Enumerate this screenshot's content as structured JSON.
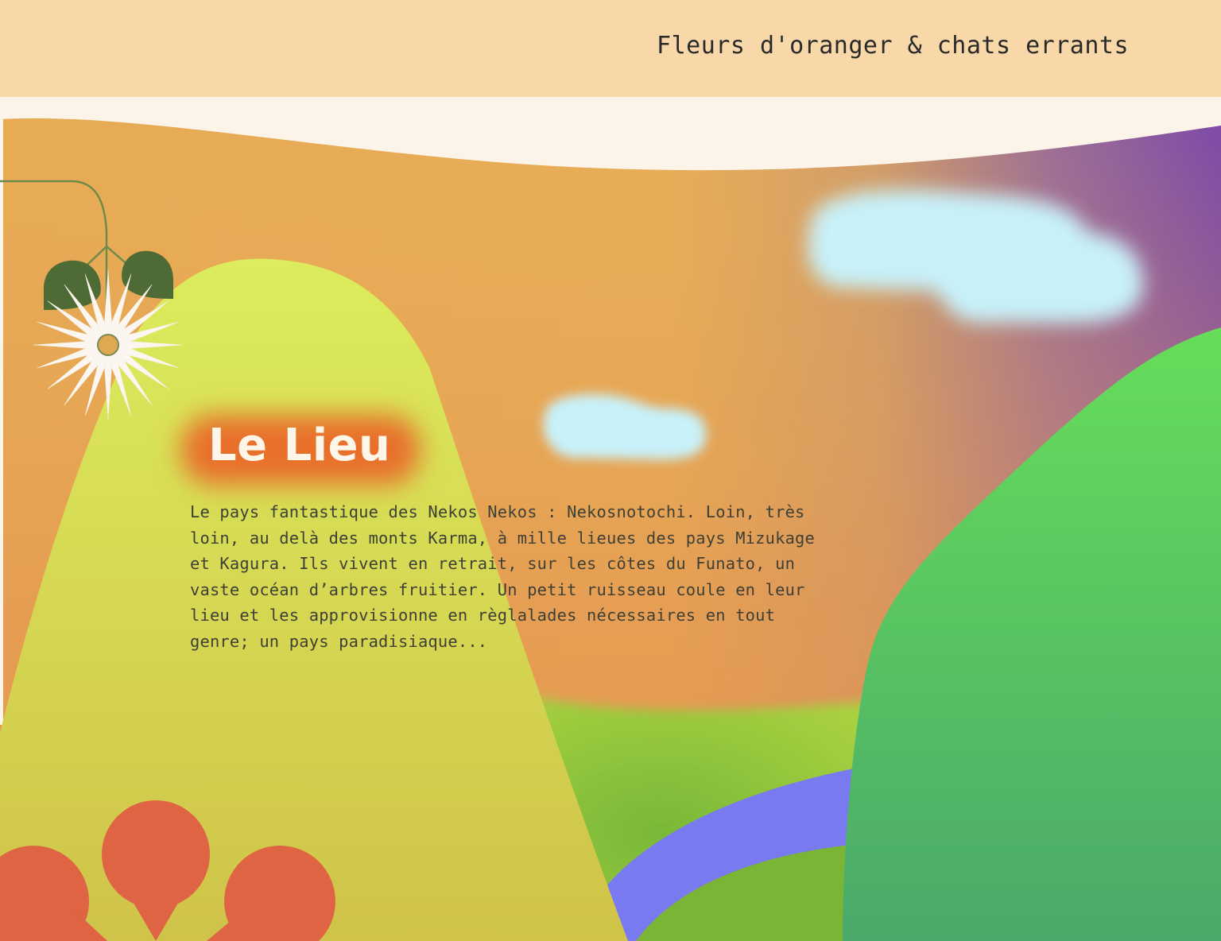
{
  "header": {
    "site_title": "Fleurs d'oranger & chats errants"
  },
  "section": {
    "heading": "Le Lieu",
    "paragraph": "Le pays fantastique des Nekos Nekos : Nekosnotochi. Loin, très loin, au delà des monts Karma, à mille lieues des pays Mizukage et Kagura. Ils vivent en retrait, sur les côtes du Funato, un vaste océan d’arbres fruitier. Un petit ruisseau coule en leur lieu et les approvisionne en règlalades nécessaires en tout genre; un pays paradisiaque..."
  },
  "decor": {
    "icons": [
      "daisy-flower-icon",
      "leaf-icon",
      "orange-blossom-icon",
      "cloud-icon"
    ],
    "colors": {
      "header_bg": "#f8d8a8",
      "sky_orange": "#e8a94f",
      "sky_purple": "#7a4aa8",
      "hill_yellow": "#d4dc55",
      "hill_green": "#5bc95a",
      "river": "#7a7af0",
      "cloud": "#c8f1f9",
      "heading_glow": "#e8702a",
      "flower_red": "#de6444"
    }
  }
}
